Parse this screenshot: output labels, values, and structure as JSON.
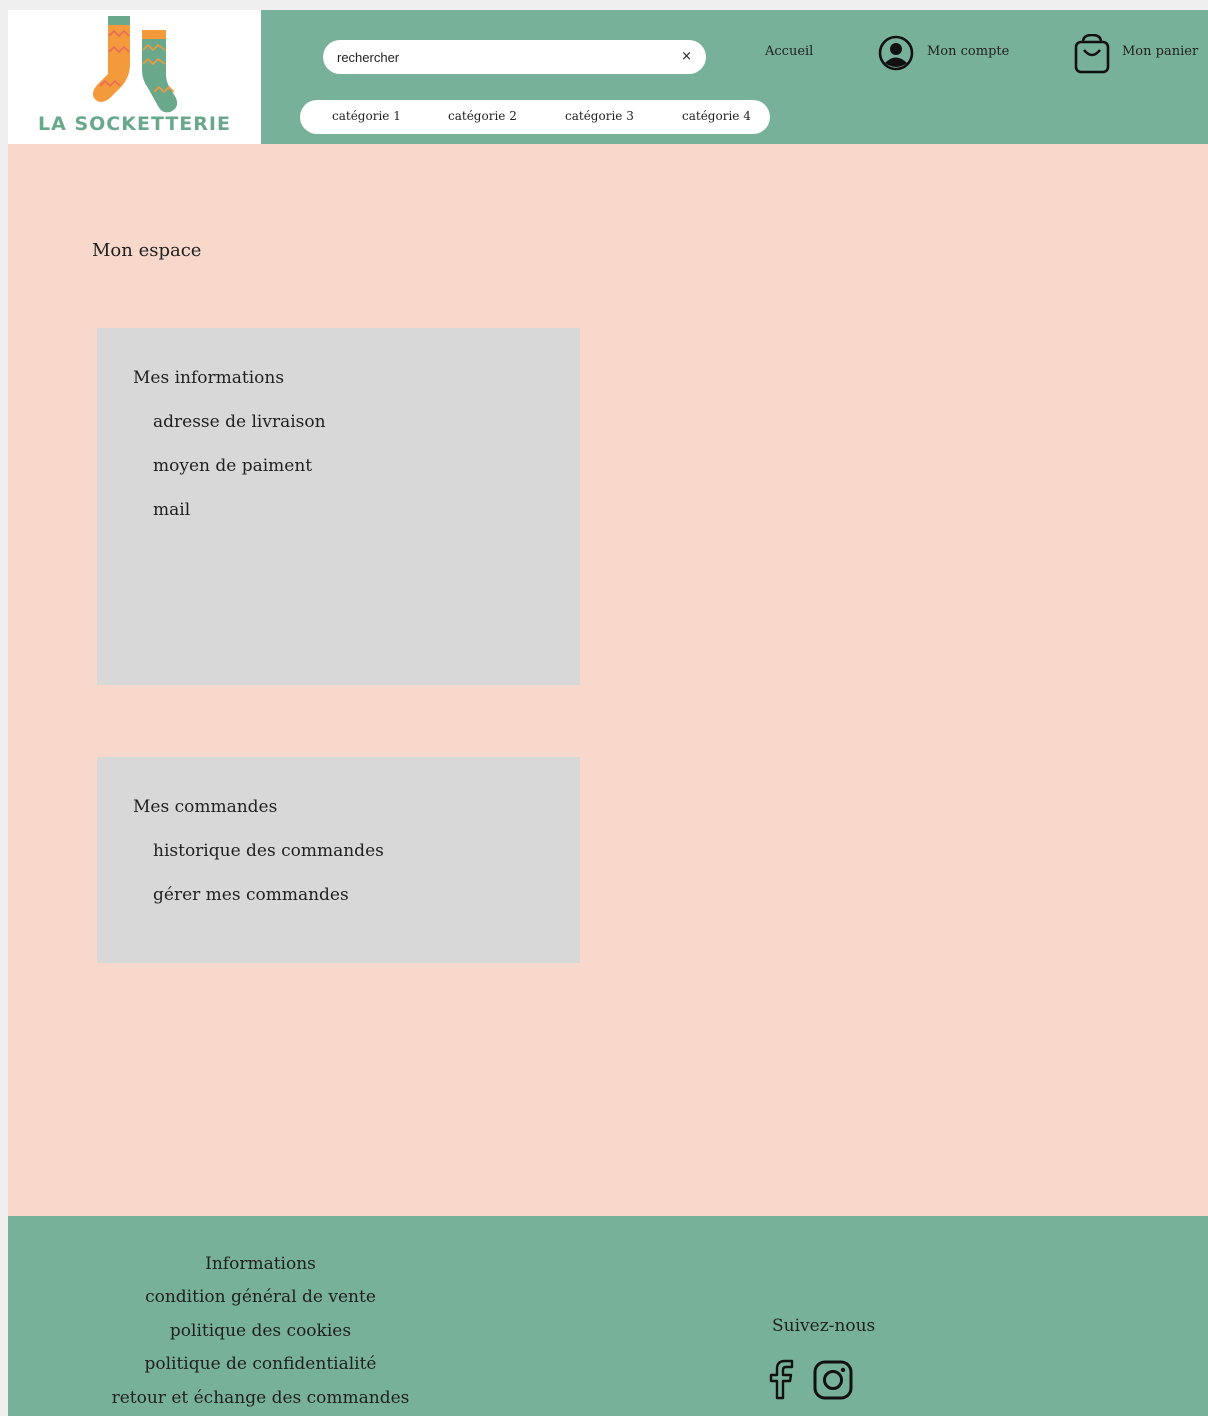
{
  "brand": {
    "name": "LA SOCKETTERIE",
    "logo_icon": "socks-icon",
    "color": "#6aa88c"
  },
  "colors": {
    "header_bg": "#78b199",
    "main_bg": "#f8d8cb",
    "card_bg": "#d8d8d8"
  },
  "search": {
    "placeholder": "rechercher",
    "value": "",
    "clear_icon": "close-icon",
    "clear_label": "×"
  },
  "nav": {
    "home": "Accueil",
    "account": {
      "label": "Mon compte",
      "icon": "user-circle-icon"
    },
    "cart": {
      "label": "Mon panier",
      "icon": "shopping-bag-icon"
    }
  },
  "categories": [
    "catégorie 1",
    "catégorie 2",
    "catégorie 3",
    "catégorie 4"
  ],
  "main": {
    "title": "Mon espace",
    "info_card": {
      "title": "Mes informations",
      "items": [
        "adresse de livraison",
        "moyen de paiment",
        "mail"
      ]
    },
    "orders_card": {
      "title": "Mes commandes",
      "items": [
        "historique des commandes",
        "gérer mes commandes"
      ]
    }
  },
  "footer": {
    "heading": "Informations",
    "links": [
      "condition général de vente",
      "politique des cookies",
      "politique de confidentialité",
      "retour et échange des commandes"
    ],
    "follow": "Suivez-nous",
    "social_icons": [
      "facebook-icon",
      "instagram-icon"
    ]
  }
}
